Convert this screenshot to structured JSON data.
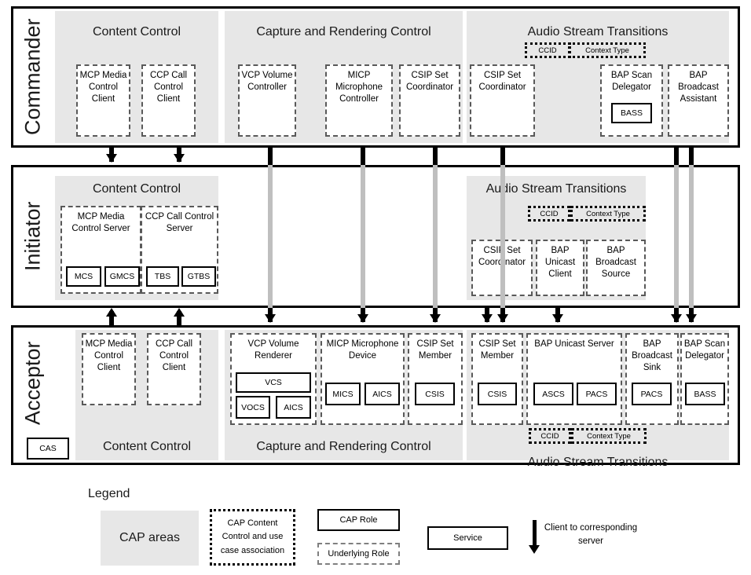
{
  "diagram": {
    "rows": [
      {
        "id": "commander",
        "label": "Commander",
        "sections": [
          {
            "id": "cc",
            "title": "Content Control"
          },
          {
            "id": "crc",
            "title": "Capture and Rendering Control"
          },
          {
            "id": "ast",
            "title": "Audio Stream Transitions"
          }
        ],
        "roles": [
          {
            "id": "mcp-client",
            "text": "MCP Media Control Client"
          },
          {
            "id": "ccp-client",
            "text": "CCP Call Control Client"
          },
          {
            "id": "vcp",
            "text": "VCP Volume Controller"
          },
          {
            "id": "micp",
            "text": "MICP Microphone Controller"
          },
          {
            "id": "csip-coord-crc",
            "text": "CSIP Set Coordinator"
          },
          {
            "id": "csip-coord-ast",
            "text": "CSIP Set Coordinator"
          },
          {
            "id": "bap-scan-delegator",
            "text": "BAP Scan Delegator"
          },
          {
            "id": "bap-broadcast-assistant",
            "text": "BAP Broadcast Assistant"
          }
        ],
        "services": [
          {
            "id": "bass",
            "text": "BASS"
          }
        ],
        "tags": [
          {
            "id": "ccid",
            "text": "CCID"
          },
          {
            "id": "context-type",
            "text": "Context Type"
          }
        ]
      },
      {
        "id": "initiator",
        "label": "Initiator",
        "sections": [
          {
            "id": "cc",
            "title": "Content Control"
          },
          {
            "id": "ast",
            "title": "Audio Stream Transitions"
          }
        ],
        "roles": [
          {
            "id": "mcp-server",
            "text": "MCP Media Control Server"
          },
          {
            "id": "ccp-server",
            "text": "CCP Call Control Server"
          },
          {
            "id": "csip-coord",
            "text": "CSIP Set Coordinator"
          },
          {
            "id": "bap-unicast-client",
            "text": "BAP Unicast Client"
          },
          {
            "id": "bap-broadcast-source",
            "text": "BAP Broadcast Source"
          }
        ],
        "services": [
          {
            "id": "mcs",
            "text": "MCS"
          },
          {
            "id": "gmcs",
            "text": "GMCS"
          },
          {
            "id": "tbs",
            "text": "TBS"
          },
          {
            "id": "gtbs",
            "text": "GTBS"
          }
        ],
        "tags": [
          {
            "id": "ccid",
            "text": "CCID"
          },
          {
            "id": "context-type",
            "text": "Context Type"
          }
        ]
      },
      {
        "id": "acceptor",
        "label": "Acceptor",
        "sections": [
          {
            "id": "cc",
            "title": "Content Control"
          },
          {
            "id": "crc",
            "title": "Capture and Rendering Control"
          },
          {
            "id": "ast",
            "title": "Audio Stream Transitions"
          }
        ],
        "roles": [
          {
            "id": "mcp-client",
            "text": "MCP Media Control Client"
          },
          {
            "id": "ccp-client",
            "text": "CCP Call Control Client"
          },
          {
            "id": "vcp-renderer",
            "text": "VCP Volume Renderer"
          },
          {
            "id": "micp-device",
            "text": "MICP Microphone Device"
          },
          {
            "id": "csip-member-crc",
            "text": "CSIP Set Member"
          },
          {
            "id": "csip-member-ast",
            "text": "CSIP Set Member"
          },
          {
            "id": "bap-unicast-server",
            "text": "BAP Unicast Server"
          },
          {
            "id": "bap-broadcast-sink",
            "text": "BAP Broadcast Sink"
          },
          {
            "id": "bap-scan-delegator",
            "text": "BAP Scan Delegator"
          }
        ],
        "services": [
          {
            "id": "cas",
            "text": "CAS"
          },
          {
            "id": "vcs",
            "text": "VCS"
          },
          {
            "id": "vocs",
            "text": "VOCS"
          },
          {
            "id": "aics-vcp",
            "text": "AICS"
          },
          {
            "id": "mics",
            "text": "MICS"
          },
          {
            "id": "aics-micp",
            "text": "AICS"
          },
          {
            "id": "csis-crc",
            "text": "CSIS"
          },
          {
            "id": "csis-ast",
            "text": "CSIS"
          },
          {
            "id": "ascs",
            "text": "ASCS"
          },
          {
            "id": "pacs-unicast",
            "text": "PACS"
          },
          {
            "id": "pacs-broadcast",
            "text": "PACS"
          },
          {
            "id": "bass",
            "text": "BASS"
          }
        ],
        "tags": [
          {
            "id": "ccid",
            "text": "CCID"
          },
          {
            "id": "context-type",
            "text": "Context Type"
          }
        ]
      }
    ]
  },
  "legend": {
    "title": "Legend",
    "items": [
      {
        "id": "cap-areas",
        "text": "CAP areas"
      },
      {
        "id": "cap-content-control",
        "text": "CAP Content Control and use case association"
      },
      {
        "id": "cap-role",
        "text": "CAP Role"
      },
      {
        "id": "underlying-role",
        "text": "Underlying Role"
      },
      {
        "id": "service",
        "text": "Service"
      },
      {
        "id": "arrow-note",
        "text": "Client to corresponding server"
      }
    ]
  },
  "colors": {
    "cap_area": "#e7e7e7",
    "frame": "#000000",
    "dashed_role": "#595959",
    "passthrough_line": "#bfbfbf"
  }
}
